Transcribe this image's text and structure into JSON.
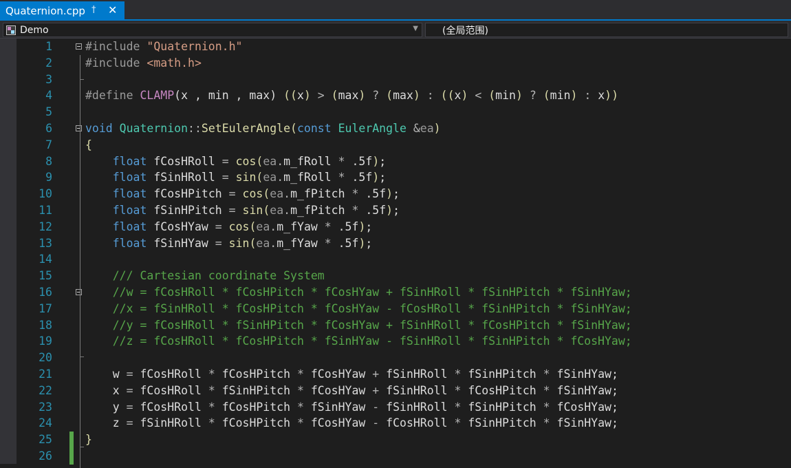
{
  "tab": {
    "title": "Quaternion.cpp",
    "pin_icon": "pin-icon",
    "close_icon": "close-icon"
  },
  "navbar": {
    "project": "Demo",
    "scope": "(全局范围)"
  },
  "editor": {
    "lines": [
      {
        "n": "1",
        "fold": true,
        "tokens": [
          [
            "pp",
            "#include "
          ],
          [
            "str",
            "\"Quaternion.h\""
          ]
        ]
      },
      {
        "n": "2",
        "tokens": [
          [
            "pp",
            "#include "
          ],
          [
            "str",
            "<math.h>"
          ]
        ]
      },
      {
        "n": "3",
        "tokens": []
      },
      {
        "n": "4",
        "tokens": [
          [
            "pp",
            "#define "
          ],
          [
            "mac",
            "CLAMP"
          ],
          [
            "pl",
            "(x , min , max) "
          ],
          [
            "br",
            "(("
          ],
          [
            "pl",
            "x"
          ],
          [
            "br",
            ")"
          ],
          [
            "op",
            " > "
          ],
          [
            "br",
            "("
          ],
          [
            "pl",
            "max"
          ],
          [
            "br",
            ")"
          ],
          [
            "op",
            " ? "
          ],
          [
            "br",
            "("
          ],
          [
            "pl",
            "max"
          ],
          [
            "br",
            ")"
          ],
          [
            "op",
            " : "
          ],
          [
            "br",
            "(("
          ],
          [
            "pl",
            "x"
          ],
          [
            "br",
            ")"
          ],
          [
            "op",
            " < "
          ],
          [
            "br",
            "("
          ],
          [
            "pl",
            "min"
          ],
          [
            "br",
            ")"
          ],
          [
            "op",
            " ? "
          ],
          [
            "br",
            "("
          ],
          [
            "pl",
            "min"
          ],
          [
            "br",
            ")"
          ],
          [
            "op",
            " : "
          ],
          [
            "pl",
            "x"
          ],
          [
            "br",
            "))"
          ]
        ]
      },
      {
        "n": "5",
        "tokens": []
      },
      {
        "n": "6",
        "fold": true,
        "tokens": [
          [
            "kw",
            "void "
          ],
          [
            "type",
            "Quaternion"
          ],
          [
            "op",
            "::"
          ],
          [
            "fn",
            "SetEulerAngle"
          ],
          [
            "br",
            "("
          ],
          [
            "kw",
            "const "
          ],
          [
            "type",
            "EulerAngle "
          ],
          [
            "op",
            "&"
          ],
          [
            "par",
            "ea"
          ],
          [
            "br",
            ")"
          ]
        ]
      },
      {
        "n": "7",
        "tokens": [
          [
            "br",
            "{"
          ]
        ]
      },
      {
        "n": "8",
        "tokens": [
          [
            "pl",
            "    "
          ],
          [
            "kw",
            "float "
          ],
          [
            "pl",
            "fCosHRoll "
          ],
          [
            "op",
            "= "
          ],
          [
            "fn",
            "cos"
          ],
          [
            "br",
            "("
          ],
          [
            "par",
            "ea"
          ],
          [
            "op",
            "."
          ],
          [
            "pl",
            "m_fRoll "
          ],
          [
            "op",
            "* "
          ],
          [
            "pl",
            ".5f"
          ],
          [
            "br",
            ")"
          ],
          [
            "pl",
            ";"
          ]
        ]
      },
      {
        "n": "9",
        "tokens": [
          [
            "pl",
            "    "
          ],
          [
            "kw",
            "float "
          ],
          [
            "pl",
            "fSinHRoll "
          ],
          [
            "op",
            "= "
          ],
          [
            "fn",
            "sin"
          ],
          [
            "br",
            "("
          ],
          [
            "par",
            "ea"
          ],
          [
            "op",
            "."
          ],
          [
            "pl",
            "m_fRoll "
          ],
          [
            "op",
            "* "
          ],
          [
            "pl",
            ".5f"
          ],
          [
            "br",
            ")"
          ],
          [
            "pl",
            ";"
          ]
        ]
      },
      {
        "n": "10",
        "tokens": [
          [
            "pl",
            "    "
          ],
          [
            "kw",
            "float "
          ],
          [
            "pl",
            "fCosHPitch "
          ],
          [
            "op",
            "= "
          ],
          [
            "fn",
            "cos"
          ],
          [
            "br",
            "("
          ],
          [
            "par",
            "ea"
          ],
          [
            "op",
            "."
          ],
          [
            "pl",
            "m_fPitch "
          ],
          [
            "op",
            "* "
          ],
          [
            "pl",
            ".5f"
          ],
          [
            "br",
            ")"
          ],
          [
            "pl",
            ";"
          ]
        ]
      },
      {
        "n": "11",
        "tokens": [
          [
            "pl",
            "    "
          ],
          [
            "kw",
            "float "
          ],
          [
            "pl",
            "fSinHPitch "
          ],
          [
            "op",
            "= "
          ],
          [
            "fn",
            "sin"
          ],
          [
            "br",
            "("
          ],
          [
            "par",
            "ea"
          ],
          [
            "op",
            "."
          ],
          [
            "pl",
            "m_fPitch "
          ],
          [
            "op",
            "* "
          ],
          [
            "pl",
            ".5f"
          ],
          [
            "br",
            ")"
          ],
          [
            "pl",
            ";"
          ]
        ]
      },
      {
        "n": "12",
        "tokens": [
          [
            "pl",
            "    "
          ],
          [
            "kw",
            "float "
          ],
          [
            "pl",
            "fCosHYaw "
          ],
          [
            "op",
            "= "
          ],
          [
            "fn",
            "cos"
          ],
          [
            "br",
            "("
          ],
          [
            "par",
            "ea"
          ],
          [
            "op",
            "."
          ],
          [
            "pl",
            "m_fYaw "
          ],
          [
            "op",
            "* "
          ],
          [
            "pl",
            ".5f"
          ],
          [
            "br",
            ")"
          ],
          [
            "pl",
            ";"
          ]
        ]
      },
      {
        "n": "13",
        "tokens": [
          [
            "pl",
            "    "
          ],
          [
            "kw",
            "float "
          ],
          [
            "pl",
            "fSinHYaw "
          ],
          [
            "op",
            "= "
          ],
          [
            "fn",
            "sin"
          ],
          [
            "br",
            "("
          ],
          [
            "par",
            "ea"
          ],
          [
            "op",
            "."
          ],
          [
            "pl",
            "m_fYaw "
          ],
          [
            "op",
            "* "
          ],
          [
            "pl",
            ".5f"
          ],
          [
            "br",
            ")"
          ],
          [
            "pl",
            ";"
          ]
        ]
      },
      {
        "n": "14",
        "tokens": []
      },
      {
        "n": "15",
        "tokens": [
          [
            "pl",
            "    "
          ],
          [
            "cmt",
            "/// Cartesian coordinate System"
          ]
        ]
      },
      {
        "n": "16",
        "fold": true,
        "tokens": [
          [
            "pl",
            "    "
          ],
          [
            "cmt",
            "//w = fCosHRoll * fCosHPitch * fCosHYaw + fSinHRoll * fSinHPitch * fSinHYaw;"
          ]
        ]
      },
      {
        "n": "17",
        "tokens": [
          [
            "pl",
            "    "
          ],
          [
            "cmt",
            "//x = fSinHRoll * fCosHPitch * fCosHYaw - fCosHRoll * fSinHPitch * fSinHYaw;"
          ]
        ]
      },
      {
        "n": "18",
        "tokens": [
          [
            "pl",
            "    "
          ],
          [
            "cmt",
            "//y = fCosHRoll * fSinHPitch * fCosHYaw + fSinHRoll * fCosHPitch * fSinHYaw;"
          ]
        ]
      },
      {
        "n": "19",
        "tokens": [
          [
            "pl",
            "    "
          ],
          [
            "cmt",
            "//z = fCosHRoll * fCosHPitch * fSinHYaw - fSinHRoll * fSinHPitch * fCosHYaw;"
          ]
        ]
      },
      {
        "n": "20",
        "tokens": []
      },
      {
        "n": "21",
        "tokens": [
          [
            "pl",
            "    w "
          ],
          [
            "op",
            "= "
          ],
          [
            "pl",
            "fCosHRoll "
          ],
          [
            "op",
            "* "
          ],
          [
            "pl",
            "fCosHPitch "
          ],
          [
            "op",
            "* "
          ],
          [
            "pl",
            "fCosHYaw "
          ],
          [
            "op",
            "+ "
          ],
          [
            "pl",
            "fSinHRoll "
          ],
          [
            "op",
            "* "
          ],
          [
            "pl",
            "fSinHPitch "
          ],
          [
            "op",
            "* "
          ],
          [
            "pl",
            "fSinHYaw;"
          ]
        ]
      },
      {
        "n": "22",
        "tokens": [
          [
            "pl",
            "    x "
          ],
          [
            "op",
            "= "
          ],
          [
            "pl",
            "fCosHRoll "
          ],
          [
            "op",
            "* "
          ],
          [
            "pl",
            "fSinHPitch "
          ],
          [
            "op",
            "* "
          ],
          [
            "pl",
            "fCosHYaw "
          ],
          [
            "op",
            "+ "
          ],
          [
            "pl",
            "fSinHRoll "
          ],
          [
            "op",
            "* "
          ],
          [
            "pl",
            "fCosHPitch "
          ],
          [
            "op",
            "* "
          ],
          [
            "pl",
            "fSinHYaw;"
          ]
        ]
      },
      {
        "n": "23",
        "tokens": [
          [
            "pl",
            "    y "
          ],
          [
            "op",
            "= "
          ],
          [
            "pl",
            "fCosHRoll "
          ],
          [
            "op",
            "* "
          ],
          [
            "pl",
            "fCosHPitch "
          ],
          [
            "op",
            "* "
          ],
          [
            "pl",
            "fSinHYaw "
          ],
          [
            "op",
            "- "
          ],
          [
            "pl",
            "fSinHRoll "
          ],
          [
            "op",
            "* "
          ],
          [
            "pl",
            "fSinHPitch "
          ],
          [
            "op",
            "* "
          ],
          [
            "pl",
            "fCosHYaw;"
          ]
        ]
      },
      {
        "n": "24",
        "tokens": [
          [
            "pl",
            "    z "
          ],
          [
            "op",
            "= "
          ],
          [
            "pl",
            "fSinHRoll "
          ],
          [
            "op",
            "* "
          ],
          [
            "pl",
            "fCosHPitch "
          ],
          [
            "op",
            "* "
          ],
          [
            "pl",
            "fCosHYaw "
          ],
          [
            "op",
            "- "
          ],
          [
            "pl",
            "fCosHRoll "
          ],
          [
            "op",
            "* "
          ],
          [
            "pl",
            "fSinHPitch "
          ],
          [
            "op",
            "* "
          ],
          [
            "pl",
            "fSinHYaw;"
          ]
        ]
      },
      {
        "n": "25",
        "changed": true,
        "tokens": [
          [
            "br",
            "}"
          ]
        ]
      },
      {
        "n": "26",
        "changed": true,
        "tokens": []
      }
    ]
  }
}
